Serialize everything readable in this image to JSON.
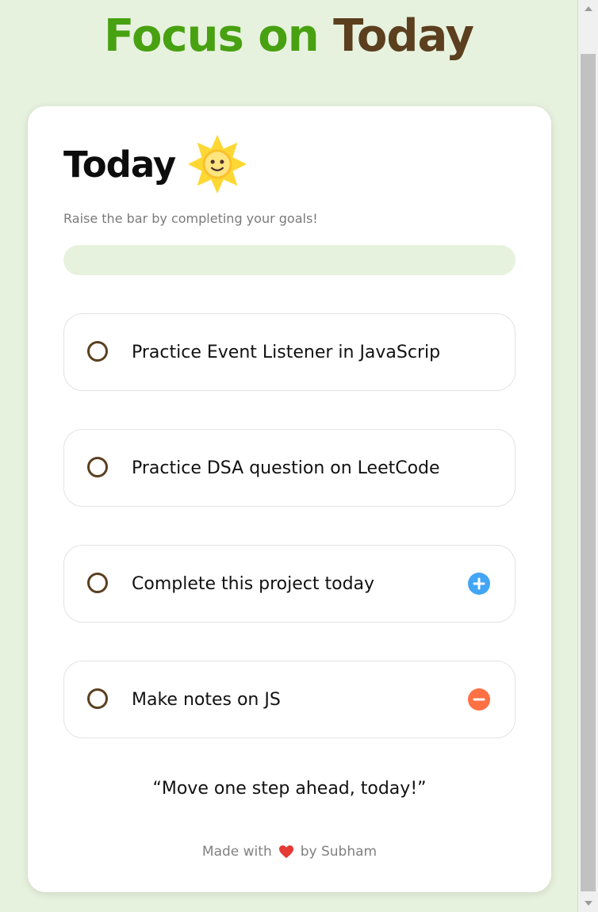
{
  "header": {
    "title_part1": "Focus on",
    "title_part2": "Today",
    "accent_color": "#48a111",
    "secondary_color": "#5b3f1f"
  },
  "card": {
    "heading": "Today",
    "heading_icon": "sun-icon",
    "subtitle": "Raise the bar by completing your goals!",
    "progress": 0
  },
  "goals": [
    {
      "text": "Practice Event Listener in JavaScrip",
      "completed": false,
      "action": ""
    },
    {
      "text": "Practice DSA question on LeetCode",
      "completed": false,
      "action": ""
    },
    {
      "text": "Complete this project today",
      "completed": false,
      "action": "add-icon"
    },
    {
      "text": "Make notes on JS",
      "completed": false,
      "action": "remove-icon"
    }
  ],
  "quote": "“Move one step ahead, today!”",
  "footer": {
    "made_with": "Made with",
    "heart_icon": "heart-icon",
    "by": "by Subham"
  },
  "colors": {
    "background": "#e7f2de",
    "add": "#42a5f5",
    "remove": "#ff7043",
    "heart": "#e53935"
  }
}
